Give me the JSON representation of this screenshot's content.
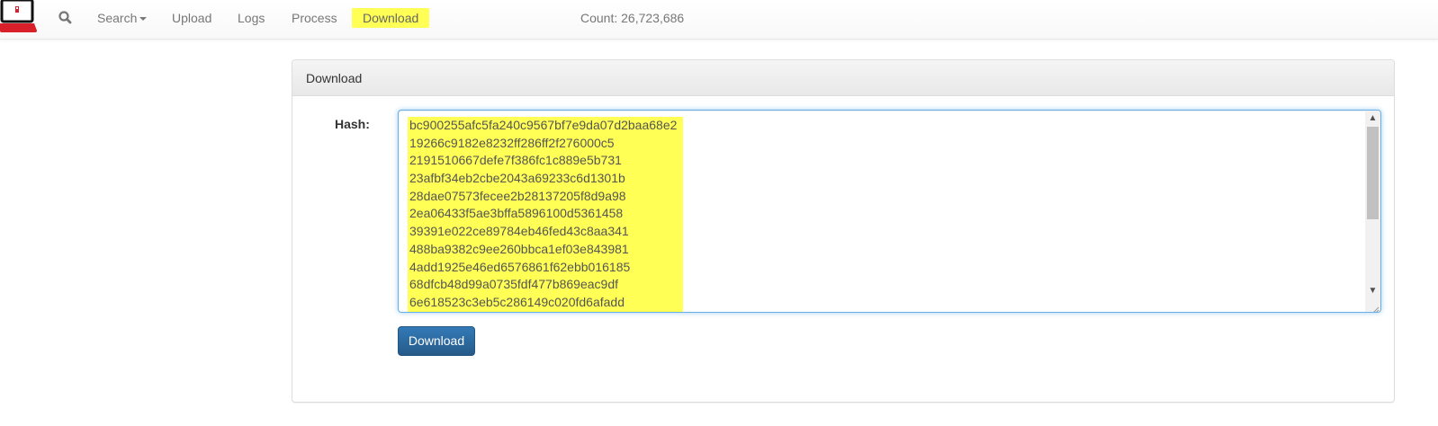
{
  "navbar": {
    "logo_icon": "laptop-logo-icon",
    "search_icon": "search-icon",
    "items": [
      {
        "label": "Search",
        "has_dropdown": true
      },
      {
        "label": "Upload"
      },
      {
        "label": "Logs"
      },
      {
        "label": "Process"
      },
      {
        "label": "Download",
        "active": true
      }
    ],
    "count": "Count: 26,723,686"
  },
  "panel": {
    "title": "Download",
    "hash_label": "Hash:",
    "hashes": [
      "bc900255afc5fa240c9567bf7e9da07d2baa68e2",
      "19266c9182e8232ff286ff2f276000c5",
      "2191510667defe7f386fc1c889e5b731",
      "23afbf34eb2cbe2043a69233c6d1301b",
      "28dae07573fecee2b28137205f8d9a98",
      "2ea06433f5ae3bffa5896100d5361458",
      "39391e022ce89784eb46fed43c8aa341",
      "488ba9382c9ee260bbca1ef03e843981",
      "4add1925e46ed6576861f62ebb016185",
      "68dfcb48d99a0735fdf477b869eac9df",
      "6e618523c3eb5c286149c020fd6afadd"
    ],
    "download_button": "Download"
  },
  "colors": {
    "highlight": "#ffff55",
    "primary_button": "#337ab7",
    "logo_red": "#d9202a"
  }
}
